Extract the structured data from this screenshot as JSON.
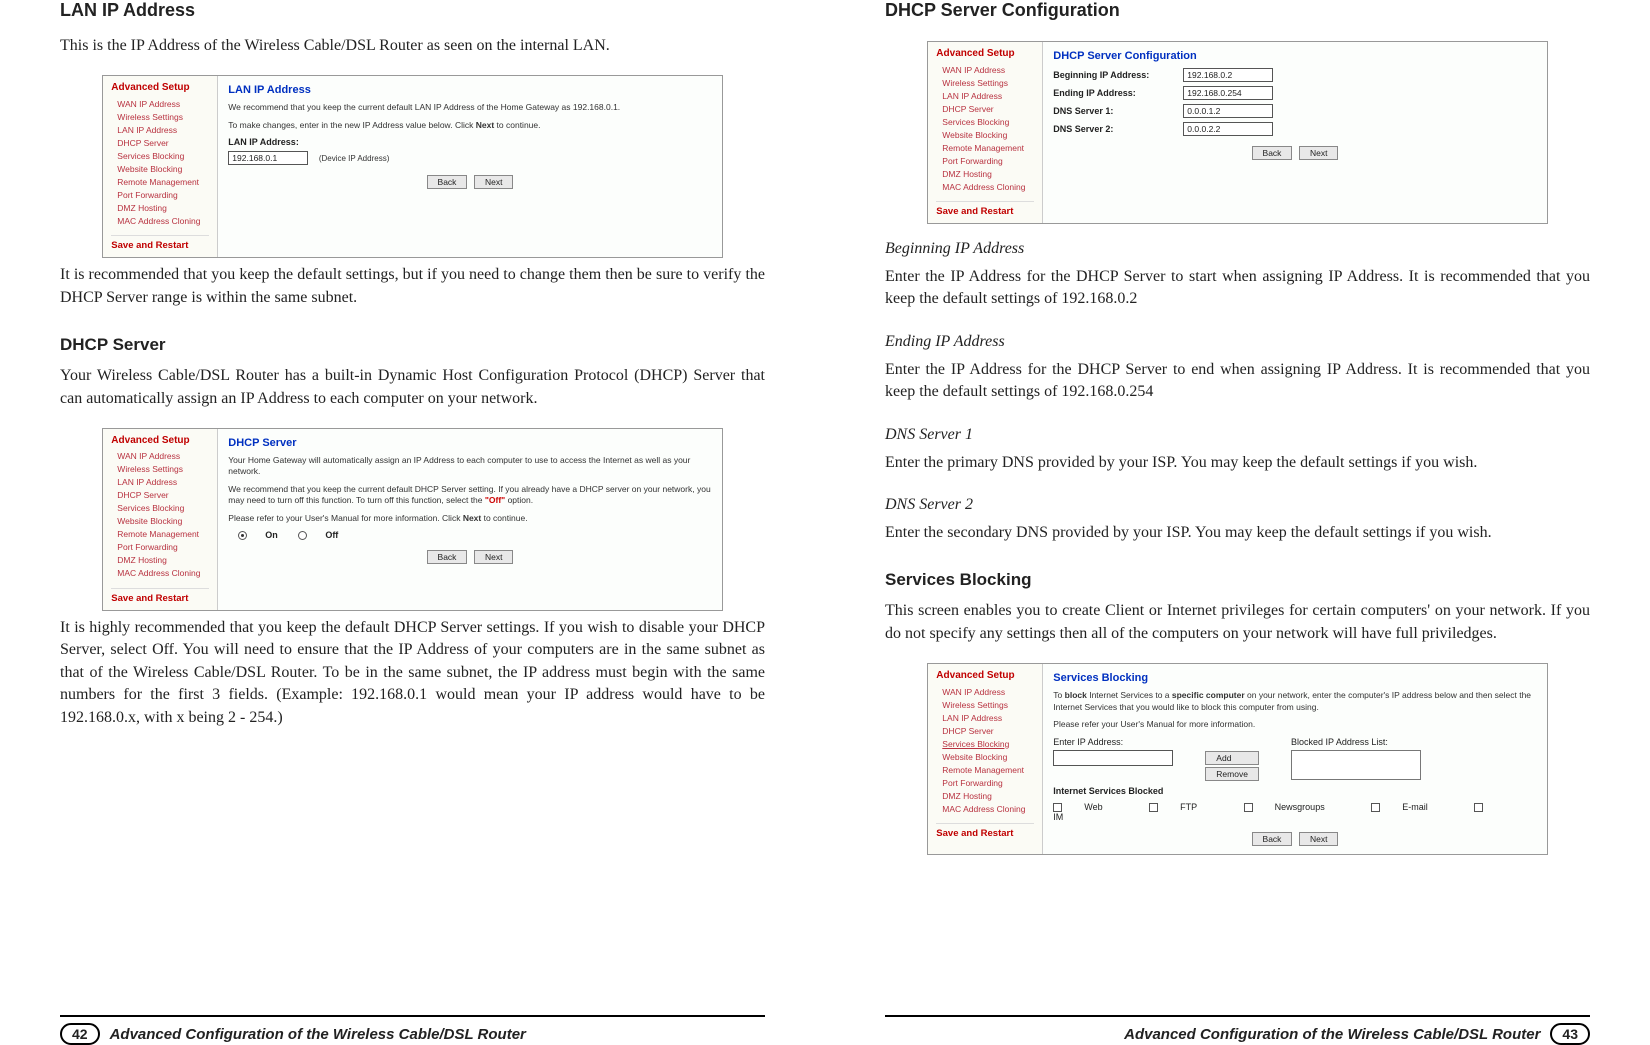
{
  "sidebar": {
    "title": "Advanced Setup",
    "items": [
      "WAN IP Address",
      "Wireless Settings",
      "LAN IP Address",
      "DHCP Server",
      "Services Blocking",
      "Website Blocking",
      "Remote Management",
      "Port Forwarding",
      "DMZ Hosting",
      "MAC Address Cloning"
    ],
    "save": "Save and Restart"
  },
  "common_buttons": {
    "back": "Back",
    "next": "Next",
    "add": "Add",
    "remove": "Remove"
  },
  "left": {
    "h_lan": "LAN IP Address",
    "p_lan1": "This is the IP Address of the Wireless Cable/DSL Router as seen on the internal LAN.",
    "shot_lan": {
      "title": "LAN IP Address",
      "t1": "We recommend that you keep the current default LAN IP Address of the Home Gateway as 192.168.0.1.",
      "t2a": "To make changes, enter in the new IP Address value below. Click ",
      "t2b": "Next",
      "t2c": " to continue.",
      "label": "LAN IP Address:",
      "value": "192.168.0.1",
      "hint": "(Device IP Address)"
    },
    "p_lan2": "It is recommended that you keep the default settings, but if you need to change them then be sure to verify the DHCP Server range is within the same subnet.",
    "h_dhcp": "DHCP Server",
    "p_dhcp1": "Your Wireless Cable/DSL Router has a built-in Dynamic Host Configuration Protocol (DHCP) Server that can automatically assign an IP Address to each computer on your network.",
    "shot_dhcp": {
      "title": "DHCP Server",
      "t1": "Your Home Gateway will automatically assign an IP Address to each computer to use to access the Internet as well as your network.",
      "t2a": "We recommend that you keep the current default DHCP Server setting. If you already have a DHCP server on your network, you may need to turn off this function. To turn off this function, select the ",
      "t2b": "\"Off\"",
      "t2c": " option.",
      "t3a": "Please refer to your User's Manual for more information. Click ",
      "t3b": "Next",
      "t3c": " to continue.",
      "on": "On",
      "off": "Off"
    },
    "p_dhcp2": "It is highly recommended that you keep the default DHCP Server settings. If you wish to disable your DHCP Server, select Off. You will need to ensure that the IP Address of your computers are in the same subnet as that of the Wireless Cable/DSL Router. To be in the same subnet, the IP address must begin with the same numbers for the first 3 fields. (Example: 192.168.0.1 would mean your IP address would have to be 192.168.0.x, with x being 2 - 254.)",
    "footer": {
      "page": "42",
      "title": "Advanced Configuration of the Wireless Cable/DSL Router"
    }
  },
  "right": {
    "h_cfg": "DHCP Server Configuration",
    "shot_cfg": {
      "title": "DHCP Server Configuration",
      "rows": [
        {
          "label": "Beginning IP Address:",
          "value": "192.168.0.2"
        },
        {
          "label": "Ending IP Address:",
          "value": "192.168.0.254"
        },
        {
          "label": "DNS Server 1:",
          "value": "0.0.0.1.2"
        },
        {
          "label": "DNS Server 2:",
          "value": "0.0.0.2.2"
        }
      ]
    },
    "sub_begin": "Beginning IP Address",
    "p_begin": "Enter the IP Address for the DHCP Server to start when assigning IP Address. It is recommended that you keep the default settings of 192.168.0.2",
    "sub_end": "Ending IP Address",
    "p_end": "Enter the IP Address for the DHCP Server to end when assigning IP Address. It is recommended that you keep the default settings of 192.168.0.254",
    "sub_dns1": "DNS Server 1",
    "p_dns1": "Enter the primary DNS provided by your ISP. You may keep the default settings if you wish.",
    "sub_dns2": "DNS Server 2",
    "p_dns2": "Enter the secondary DNS provided by your ISP. You may keep the default settings if you wish.",
    "h_sb": "Services Blocking",
    "p_sb": "This screen enables you to create Client or Internet privileges for certain computers' on your network. If you do not specify any settings then all of the computers on your network will have full priviledges.",
    "shot_sb": {
      "title": "Services Blocking",
      "t1a": "To ",
      "t1b": "block",
      "t1c": " Internet Services to a ",
      "t1d": "specific computer",
      "t1e": " on your network, enter the computer's IP address below and then select the Internet Services that you would like to block this computer from using.",
      "t2": "Please refer your User's Manual for more information.",
      "enter_label": "Enter IP Address:",
      "blocked_label": "Blocked IP Address List:",
      "isb_label": "Internet Services Blocked",
      "cbs": [
        "Web",
        "FTP",
        "Newsgroups",
        "E-mail",
        "IM"
      ]
    },
    "footer": {
      "page": "43",
      "title": "Advanced Configuration of the Wireless Cable/DSL Router"
    }
  }
}
